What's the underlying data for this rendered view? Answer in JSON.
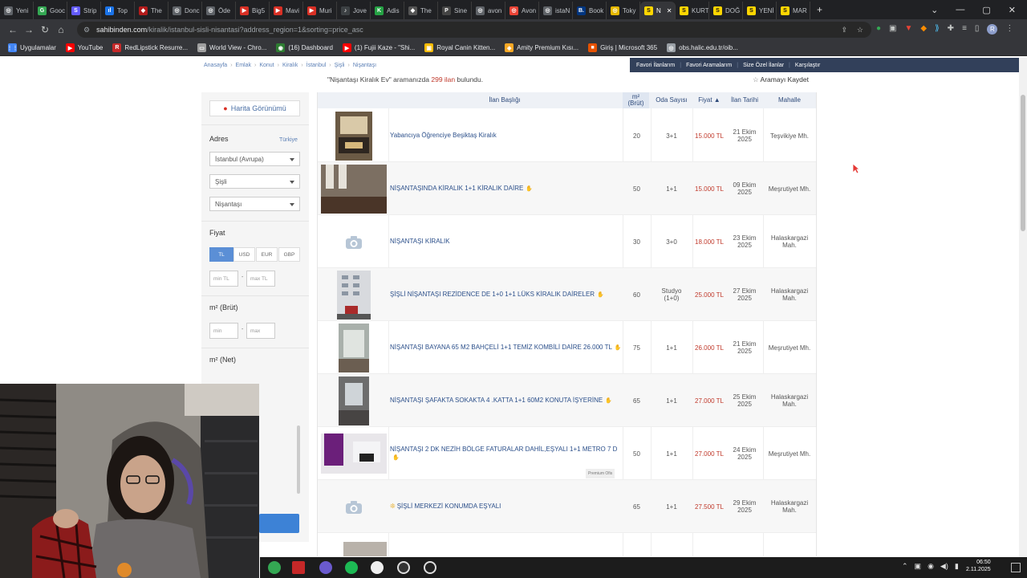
{
  "browser": {
    "tabs": [
      {
        "label": "Yeni",
        "color": "#5f6368",
        "glyph": "◎"
      },
      {
        "label": "Gooc",
        "color": "#34a853",
        "glyph": "G"
      },
      {
        "label": "Strip",
        "color": "#635bff",
        "glyph": "S"
      },
      {
        "label": "Top",
        "color": "#1a73e8",
        "glyph": "ıl"
      },
      {
        "label": "The",
        "color": "#b31b1b",
        "glyph": "◆"
      },
      {
        "label": "Donc",
        "color": "#5f6368",
        "glyph": "◎"
      },
      {
        "label": "Öde",
        "color": "#5f6368",
        "glyph": "◎"
      },
      {
        "label": "Big5",
        "color": "#d93025",
        "glyph": "▶"
      },
      {
        "label": "Mavi",
        "color": "#d93025",
        "glyph": "▶"
      },
      {
        "label": "Muri",
        "color": "#d93025",
        "glyph": "▶"
      },
      {
        "label": "Jove",
        "color": "#3c4043",
        "glyph": "♪"
      },
      {
        "label": "Adis",
        "color": "#25a244",
        "glyph": "K"
      },
      {
        "label": "The",
        "color": "#555",
        "glyph": "◆"
      },
      {
        "label": "Sine",
        "color": "#444",
        "glyph": "P"
      },
      {
        "label": "avon",
        "color": "#5f6368",
        "glyph": "◎"
      },
      {
        "label": "Avon",
        "color": "#ea4335",
        "glyph": "◎"
      },
      {
        "label": "istaN",
        "color": "#5f6368",
        "glyph": "◎"
      },
      {
        "label": "Book",
        "color": "#003580",
        "glyph": "B."
      },
      {
        "label": "Toky",
        "color": "#e6b800",
        "glyph": "◎"
      },
      {
        "label": "N",
        "color": "#ffd600",
        "glyph": "S",
        "active": true
      },
      {
        "label": "KURT",
        "color": "#ffd600",
        "glyph": "S"
      },
      {
        "label": "DOĞ",
        "color": "#ffd600",
        "glyph": "S"
      },
      {
        "label": "YENİ",
        "color": "#ffd600",
        "glyph": "S"
      },
      {
        "label": "MAR",
        "color": "#ffd600",
        "glyph": "S"
      }
    ],
    "new_tab": "+",
    "url_host": "sahibinden.com",
    "url_path": "/kiralik/istanbul-sisli-nisantasi?address_region=1&sorting=price_asc",
    "bookmarks": [
      {
        "label": "Uygulamalar",
        "color": "#4285f4",
        "glyph": "⋮⋮"
      },
      {
        "label": "YouTube",
        "color": "#ff0000",
        "glyph": "▶"
      },
      {
        "label": "RedLipstick Resurre...",
        "color": "#c62828",
        "glyph": "R"
      },
      {
        "label": "World View - Chro...",
        "color": "#9e9e9e",
        "glyph": "▭"
      },
      {
        "label": "(16) Dashboard",
        "color": "#2e7d32",
        "glyph": "◉"
      },
      {
        "label": "(1) Fujii Kaze - \"Shi...",
        "color": "#ff0000",
        "glyph": "▶"
      },
      {
        "label": "Royal Canin Kitten...",
        "color": "#fbbc04",
        "glyph": "▣"
      },
      {
        "label": "Amity Premium Kısı...",
        "color": "#f9a825",
        "glyph": "◈"
      },
      {
        "label": "Giriş | Microsoft 365",
        "color": "#e65100",
        "glyph": "■"
      },
      {
        "label": "obs.halic.edu.tr/oib...",
        "color": "#9aa0a6",
        "glyph": "◎"
      }
    ]
  },
  "site": {
    "breadcrumbs": [
      "Anasayfa",
      "Emlak",
      "Konut",
      "Kiralık",
      "İstanbul",
      "Şişli",
      "Nişantaşı"
    ],
    "topnav": [
      "Favori İlanlarım",
      "Favori Aramalarım",
      "Size Özel İlanlar",
      "Karşılaştır"
    ],
    "summary_query": "\"Nişantaşı Kiralık Ev\"",
    "summary_mid": " aramanızda ",
    "summary_count": "299 ilan",
    "summary_end": " bulundu.",
    "save_search": "Aramayı Kaydet"
  },
  "sidebar": {
    "map_view": "Harita Görünümü",
    "address_title": "Adres",
    "country": "Türkiye",
    "city": "İstanbul (Avrupa)",
    "district": "Şişli",
    "neighborhood": "Nişantaşı",
    "price_title": "Fiyat",
    "currencies": [
      "TL",
      "USD",
      "EUR",
      "GBP"
    ],
    "min_price": "min TL",
    "max_price": "max TL",
    "gross_title": "m² (Brüt)",
    "net_title": "m² (Net)",
    "min": "min",
    "max": "max",
    "dash": "-"
  },
  "table": {
    "headers": {
      "title": "İlan Başlığı",
      "m2": "m²\n(Brüt)",
      "rooms": "Oda Sayısı",
      "price": "Fiyat ▲",
      "date": "İlan Tarihi",
      "area": "Mahalle"
    },
    "rows": [
      {
        "title": "Yabancıya Öğrenciye Beşiktaş Kiralık",
        "m2": "20",
        "rooms": "3+1",
        "price": "15.000 TL",
        "date": "21 Ekim\n2025",
        "area": "Teşvikiye Mh.",
        "thumb": "photo-warm",
        "pin": false
      },
      {
        "title": "NİŞANTAŞINDA KİRALIK 1+1 KİRALIK DAİRE",
        "m2": "50",
        "rooms": "1+1",
        "price": "15.000 TL",
        "date": "09 Ekim\n2025",
        "area": "Meşrutiyet Mh.",
        "thumb": "photo-room",
        "pin": true
      },
      {
        "title": "NİŞANTAŞI KİRALIK",
        "m2": "30",
        "rooms": "3+0",
        "price": "18.000 TL",
        "date": "23 Ekim\n2025",
        "area": "Halaskargazi\nMah.",
        "thumb": "none",
        "pin": false
      },
      {
        "title": "ŞİŞLİ NİŞANTAŞI REZİDENCE DE 1+0 1+1 LÜKS KİRALIK DAİRELER",
        "m2": "60",
        "rooms": "Studyo\n(1+0)",
        "price": "25.000 TL",
        "date": "27 Ekim\n2025",
        "area": "Halaskargazi\nMah.",
        "thumb": "photo-building",
        "pin": true
      },
      {
        "title": "NİŞANTAŞI BAYANA 65 M2 BAHÇELİ 1+1 TEMİZ KOMBİLİ DAİRE 26.000 TL",
        "m2": "75",
        "rooms": "1+1",
        "price": "26.000 TL",
        "date": "21 Ekim\n2025",
        "area": "Meşrutiyet Mh.",
        "thumb": "photo-hall",
        "pin": true
      },
      {
        "title": "NİŞANTAŞI ŞAFAKTA SOKAKTA 4 .KATTA 1+1 60M2 KONUTA İŞYERİNE",
        "m2": "65",
        "rooms": "1+1",
        "price": "27.000 TL",
        "date": "25 Ekim\n2025",
        "area": "Halaskargazi\nMah.",
        "thumb": "photo-window",
        "pin": true
      },
      {
        "title": "NİŞANTAŞI 2 DK NEZİH BÖLGE FATURALAR DAHİL,EŞYALI 1+1 METRO 7 D",
        "m2": "50",
        "rooms": "1+1",
        "price": "27.000 TL",
        "date": "24 Ekim\n2025",
        "area": "Meşrutiyet Mh.",
        "thumb": "photo-purple",
        "pin": true,
        "badge": "Premium Ofis"
      },
      {
        "title": "ŞİŞLİ MERKEZİ KONUMDA EŞYALI",
        "m2": "65",
        "rooms": "1+1",
        "price": "27.500 TL",
        "date": "29 Ekim\n2025",
        "area": "Halaskargazi\nMah.",
        "thumb": "none",
        "pin": false,
        "prefix": "❊"
      }
    ]
  },
  "taskbar": {
    "time": "06:50",
    "date": "2.11.2025"
  }
}
